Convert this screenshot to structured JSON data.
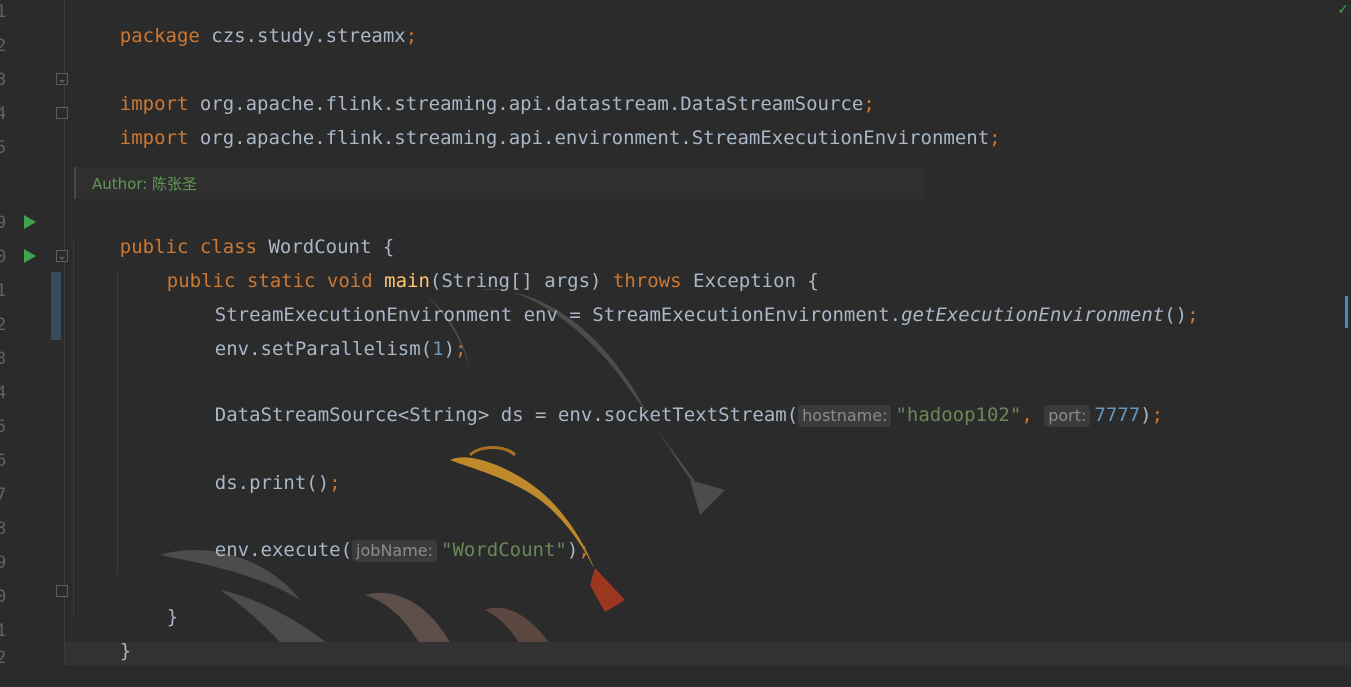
{
  "gutter": {
    "line_numbers": [
      "1",
      "2",
      "3",
      "4",
      "5",
      "9",
      "0",
      "1",
      "2",
      "3",
      "4",
      "5",
      "6",
      "7",
      "8",
      "9",
      "0",
      "1",
      "2"
    ]
  },
  "author": {
    "text": "Author: 陈张圣"
  },
  "code": {
    "l1": {
      "kw": "package",
      "rest": " czs.study.streamx",
      "semi": ";"
    },
    "l3": {
      "kw": "import",
      "rest": " org.apache.flink.streaming.api.datastream.DataStreamSource",
      "semi": ";"
    },
    "l4": {
      "kw": "import",
      "rest": " org.apache.flink.streaming.api.environment.StreamExecutionEnvironment",
      "semi": ";"
    },
    "l9": {
      "kw": "public class",
      "name": " WordCount ",
      "brace": "{"
    },
    "l10": {
      "kw1": "public static void",
      "fn": "main",
      "args": "(String[] args) ",
      "kw2": "throws",
      "rest": " Exception {"
    },
    "l11": {
      "a": "StreamExecutionEnvironment env = StreamExecutionEnvironment.",
      "it": "getExecutionEnvironment",
      "b": "()",
      "semi": ";"
    },
    "l12": {
      "a": "env.setParallelism(",
      "num": "1",
      "b": ")",
      "semi": ";"
    },
    "l14": {
      "a": "DataStreamSource<String> ds = env.socketTextStream(",
      "hint1": "hostname:",
      "str": "\"hadoop102\"",
      "comma": ",",
      "hint2": "port:",
      "num": "7777",
      "b": ")",
      "semi": ";"
    },
    "l16": {
      "a": "ds.print()",
      "semi": ";"
    },
    "l18": {
      "a": "env.execute(",
      "hint": "jobName:",
      "str": "\"WordCount\"",
      "b": ")",
      "semi": ";"
    },
    "l20": {
      "a": "}"
    },
    "l21": {
      "a": "}"
    }
  },
  "colors": {
    "background": "#2b2b2b",
    "keyword": "#cc7832",
    "function": "#ffc66d",
    "string": "#6a8759",
    "number": "#6897bb",
    "text": "#a9b7c6"
  }
}
